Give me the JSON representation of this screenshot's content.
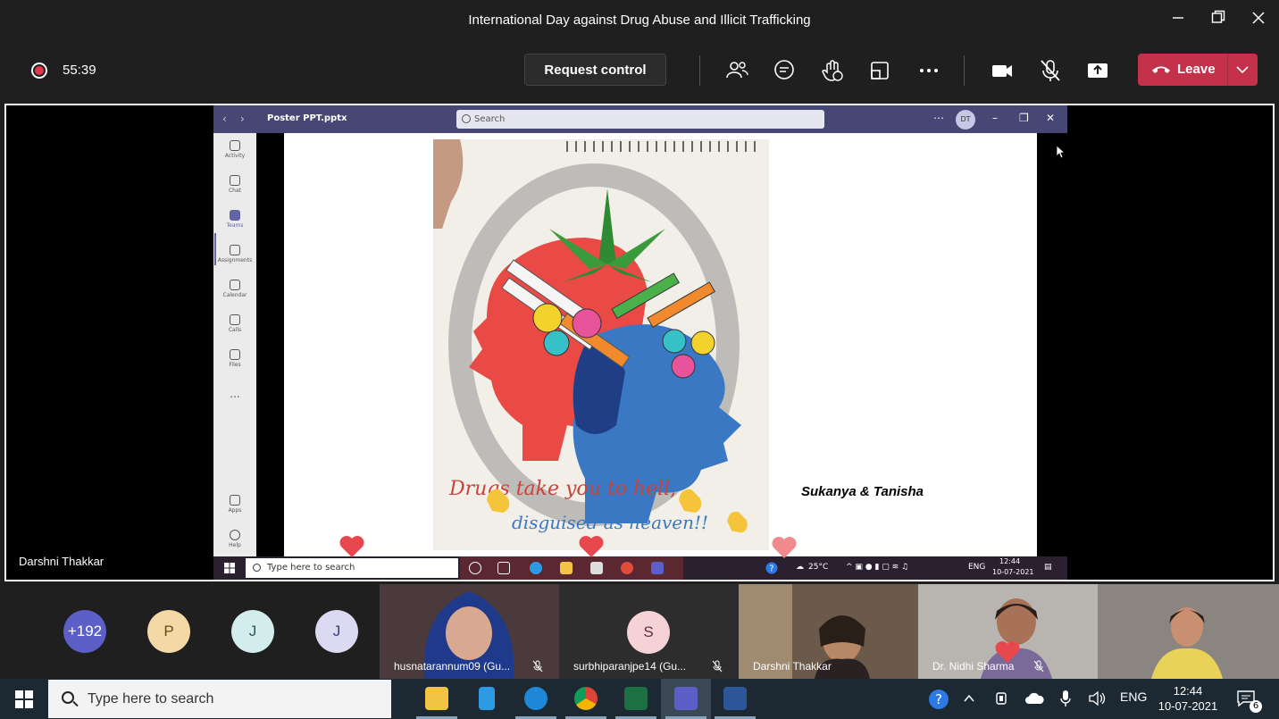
{
  "window": {
    "title": "International Day against Drug Abuse and Illicit Trafficking"
  },
  "toolbar": {
    "timer": "55:39",
    "request_control_label": "Request control",
    "leave_label": "Leave"
  },
  "stage": {
    "presenter_name": "Darshni Thakkar"
  },
  "shared_screen": {
    "file_title": "Poster PPT.pptx",
    "search_placeholder": "Search",
    "avatar_initials": "DT",
    "rail": [
      {
        "label": "Activity"
      },
      {
        "label": "Chat"
      },
      {
        "label": "Teams"
      },
      {
        "label": "Assignments"
      },
      {
        "label": "Calendar"
      },
      {
        "label": "Calls"
      },
      {
        "label": "Files"
      },
      {
        "label": "..."
      },
      {
        "label": "Apps"
      },
      {
        "label": "Help"
      }
    ],
    "slide": {
      "poster_line1": "Drugs take you to hell,",
      "poster_line2": "disguised as heaven!!",
      "credit": "Sukanya & Tanisha"
    },
    "taskbar": {
      "search_placeholder": "Type here to search",
      "weather": "25°C",
      "lang": "ENG",
      "time": "12:44",
      "date": "10-07-2021"
    }
  },
  "participants": {
    "overflow_count": "+192",
    "circles": [
      {
        "initial": "P",
        "color": "#f4d9a6",
        "text_color": "#6a4a10"
      },
      {
        "initial": "J",
        "color": "#d3ecec",
        "text_color": "#2a5b5b"
      },
      {
        "initial": "J",
        "color": "#dcd9f2",
        "text_color": "#3d3a78"
      }
    ],
    "tiles": [
      {
        "name": "husnatarannum09 (Gu..."
      },
      {
        "name": "surbhiparanjpe14 (Gu...",
        "initial": "S"
      },
      {
        "name": "Darshni Thakkar"
      },
      {
        "name": "Dr. Nidhi Sharma"
      },
      {
        "name": ""
      }
    ]
  },
  "taskbar": {
    "search_placeholder": "Type here to search",
    "lang": "ENG",
    "time": "12:44",
    "date": "10-07-2021",
    "notification_count": "6"
  },
  "colors": {
    "leave": "#c4314b",
    "teams_purple": "#464775",
    "reaction_heart": "#e8474e"
  }
}
